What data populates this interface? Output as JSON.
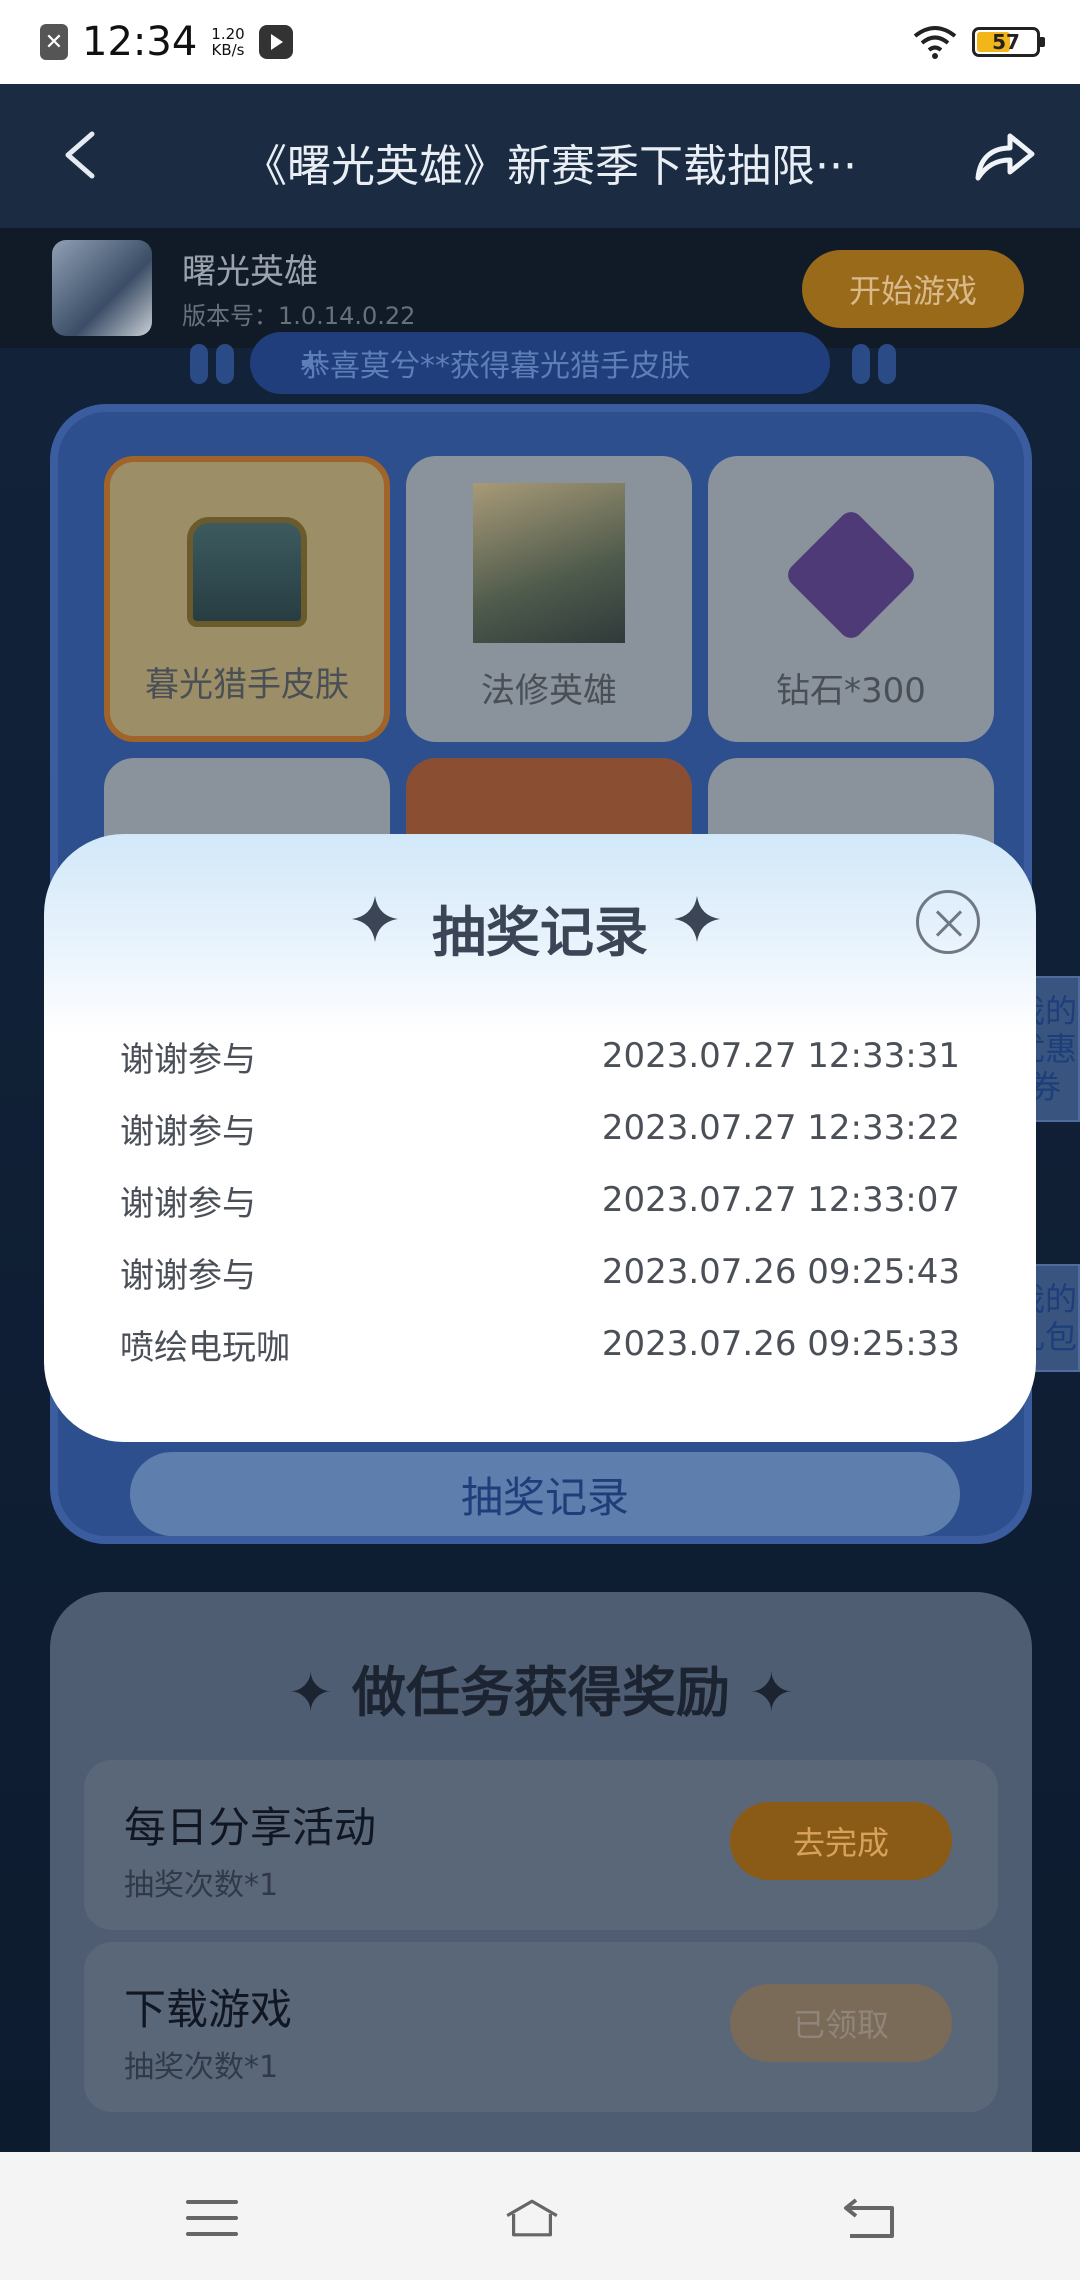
{
  "status_bar": {
    "time": "12:34",
    "speed_value": "1.20",
    "speed_unit": "KB/s",
    "battery": "57",
    "battery_level": 0.57
  },
  "header": {
    "title": "《曙光英雄》新赛季下载抽限···"
  },
  "game": {
    "name": "曙光英雄",
    "version": "版本号：1.0.14.0.22",
    "start_label": "开始游戏"
  },
  "notice": {
    "text": "恭喜莫兮**获得暮光猎手皮肤"
  },
  "prizes": [
    {
      "label": "暮光猎手皮肤"
    },
    {
      "label": "法修英雄"
    },
    {
      "label": "钻石*300"
    }
  ],
  "lottery": {
    "record_button": "抽奖记录"
  },
  "side_tabs": {
    "coupons": "我的优惠券",
    "gifts": "我的礼包"
  },
  "tasks": {
    "title": "做任务获得奖励",
    "items": [
      {
        "name": "每日分享活动",
        "sub": "抽奖次数*1",
        "button": "去完成"
      },
      {
        "name": "下载游戏",
        "sub": "抽奖次数*1",
        "button": "已领取"
      }
    ]
  },
  "modal": {
    "title": "抽奖记录",
    "records": [
      {
        "prize": "谢谢参与",
        "time": "2023.07.27 12:33:31"
      },
      {
        "prize": "谢谢参与",
        "time": "2023.07.27 12:33:22"
      },
      {
        "prize": "谢谢参与",
        "time": "2023.07.27 12:33:07"
      },
      {
        "prize": "谢谢参与",
        "time": "2023.07.26 09:25:43"
      },
      {
        "prize": "喷绘电玩咖",
        "time": "2023.07.26 09:25:33"
      }
    ]
  },
  "icons": {
    "back": "chevron-left-icon",
    "share": "share-icon",
    "close": "close-icon",
    "menu": "menu-icon",
    "home": "home-icon",
    "return": "return-icon"
  }
}
